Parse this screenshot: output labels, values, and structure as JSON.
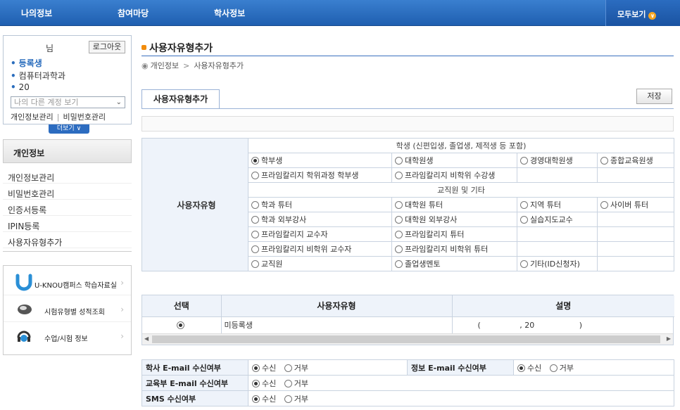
{
  "nav": {
    "items": [
      "나의정보",
      "참여마당",
      "학사정보"
    ],
    "all_view": "모두보기"
  },
  "user": {
    "name_suffix": "님",
    "logout": "로그아웃",
    "status": "등록생",
    "dept": "컴퓨터과학과",
    "id_prefix": "20",
    "account_select": "나의 다른 계정 보기",
    "link_info": "개인정보관리",
    "link_pw": "비밀번호관리",
    "more": "더보기"
  },
  "sidemenu": {
    "title": "개인정보",
    "items": [
      "개인정보관리",
      "비밀번호관리",
      "인증서등록",
      "IPIN등록",
      "사용자유형추가"
    ]
  },
  "promo": {
    "items": [
      "U-KNOU캠퍼스 학습자료실",
      "시험유형별 성적조회",
      "수업/시험 정보"
    ]
  },
  "page": {
    "title": "사용자유형추가",
    "breadcrumb": [
      "개인정보",
      "사용자유형추가"
    ],
    "tab": "사용자유형추가",
    "save": "저장"
  },
  "type_table": {
    "label": "사용자유형",
    "student_header": "학생 (신편입생, 졸업생, 제적생 등 포함)",
    "student_rows": [
      [
        "학부생",
        "대학원생",
        "경영대학원생",
        "종합교육원생"
      ],
      [
        "프라임칼리지 학위과정 학부생",
        "프라임칼리지 비학위 수강생",
        "",
        ""
      ]
    ],
    "staff_header": "교직원 및 기타",
    "staff_rows": [
      [
        "학과 튜터",
        "대학원 튜터",
        "지역 튜터",
        "사이버 튜터"
      ],
      [
        "학과 외부강사",
        "대학원 외부강사",
        "실습지도교수",
        ""
      ],
      [
        "프라임칼리지 교수자",
        "프라임칼리지 튜터",
        "",
        ""
      ],
      [
        "프라임칼리지 비학위 교수자",
        "프라임칼리지 비학위 튜터",
        "",
        ""
      ],
      [
        "교직원",
        "졸업생멘토",
        "기타(ID신청자)",
        ""
      ]
    ],
    "selected": "학부생"
  },
  "list_table": {
    "headers": [
      "선택",
      "사용자유형",
      "설명"
    ],
    "row": {
      "type": "미등록생",
      "desc_open": "(",
      "desc_mid": ", 20",
      "desc_close": ")"
    }
  },
  "consent": {
    "rows": [
      {
        "label": "학사 E-mail 수신여부",
        "label2": "정보 E-mail 수신여부"
      },
      {
        "label": "교육부 E-mail 수신여부"
      },
      {
        "label": "SMS 수신여부"
      }
    ],
    "yes": "수신",
    "no": "거부"
  }
}
